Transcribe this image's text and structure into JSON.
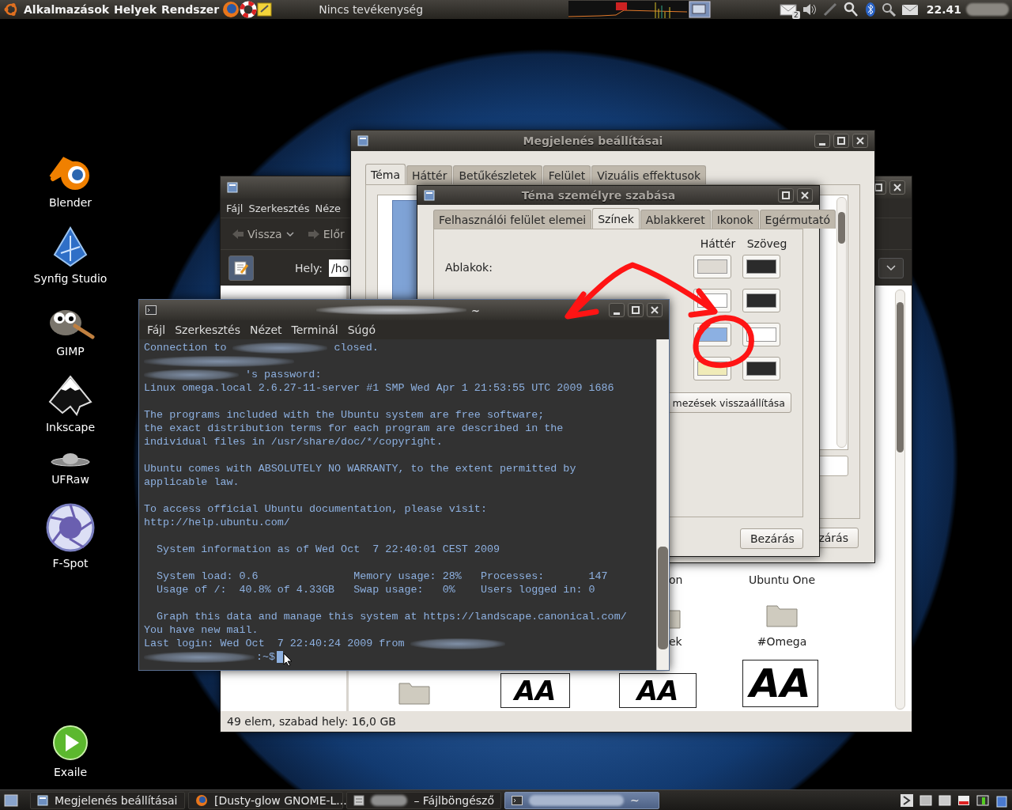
{
  "top_panel": {
    "menus": [
      "Alkalmazások",
      "Helyek",
      "Rendszer"
    ],
    "status": "Nincs tevékenység",
    "mail_count": "2",
    "clock": "22.41"
  },
  "desktop_icons": [
    {
      "kind": "blender",
      "label": "Blender"
    },
    {
      "kind": "synfig",
      "label": "Synfig Studio"
    },
    {
      "kind": "gimp",
      "label": "GIMP"
    },
    {
      "kind": "inkscape",
      "label": "Inkscape"
    },
    {
      "kind": "ufraw",
      "label": "UFRaw"
    },
    {
      "kind": "fspot",
      "label": "F-Spot"
    },
    {
      "kind": "exaile",
      "label": "Exaile"
    }
  ],
  "file_manager": {
    "menus": [
      "Fájl",
      "Szerkesztés",
      "Néze"
    ],
    "back": "Vissza",
    "forward": "Előr",
    "location_label": "Hely:",
    "location_value": "/ho",
    "items": [
      {
        "kind": "label",
        "label": "on"
      },
      {
        "kind": "label",
        "label": "Ubuntu One"
      },
      {
        "kind": "folder",
        "label": "ek"
      },
      {
        "kind": "folder",
        "label": "#Omega"
      },
      {
        "kind": "folder"
      },
      {
        "kind": "font",
        "sample": "AA"
      },
      {
        "kind": "font",
        "sample": "AA"
      },
      {
        "kind": "font",
        "sample": "AA"
      }
    ],
    "status": "49 elem, szabad hely: 16,0 GB"
  },
  "appearance_dialog": {
    "title": "Megjelenés beállításai",
    "tabs": [
      {
        "label": "Téma",
        "selected": true
      },
      {
        "label": "Háttér",
        "selected": false
      },
      {
        "label": "Betűkészletek",
        "selected": false
      },
      {
        "label": "Felület",
        "selected": false
      },
      {
        "label": "Vizuális effektusok",
        "selected": false
      }
    ],
    "close_button": "zárás"
  },
  "theme_dialog": {
    "title": "Téma személyre szabása",
    "tabs": [
      {
        "label": "Felhasználói felület elemei",
        "selected": false
      },
      {
        "label": "Színek",
        "selected": true
      },
      {
        "label": "Ablakkeret",
        "selected": false
      },
      {
        "label": "Ikonok",
        "selected": false
      },
      {
        "label": "Egérmutató",
        "selected": false
      }
    ],
    "columns": [
      "Háttér",
      "Szöveg"
    ],
    "rows": [
      {
        "label": "Ablakok:",
        "background": {
          "color": "#dedad3"
        },
        "text": {
          "color": "#2b2b2b"
        }
      },
      {
        "background": {
          "color": "#ffffff"
        },
        "text": {
          "color": "#2b2b2b"
        }
      },
      {
        "background": {
          "color": "#8cb0e2"
        },
        "text": {
          "color": "#ffffff"
        }
      },
      {
        "background": {
          "color": "#f0ebb8"
        },
        "text": {
          "color": "#2b2b2b"
        }
      }
    ],
    "reset_button": "mezések visszaállítása",
    "close_button": "Bezárás"
  },
  "terminal": {
    "title": "~",
    "menus": [
      "Fájl",
      "Szerkesztés",
      "Nézet",
      "Terminál",
      "Súgó"
    ],
    "lines": [
      {
        "kind": "text",
        "parts": [
          {
            "kind": "text",
            "text": "Connection to"
          },
          {
            "kind": "blur"
          },
          {
            "kind": "text",
            "text": "closed."
          }
        ]
      },
      {
        "kind": "text",
        "parts": [
          {
            "kind": "blur"
          }
        ]
      },
      {
        "kind": "text",
        "parts": [
          {
            "kind": "blur"
          },
          {
            "kind": "text",
            "text": "'s password:"
          }
        ]
      },
      {
        "kind": "text",
        "parts": [
          {
            "kind": "text",
            "text": "Linux omega.local 2.6.27-11-server #1 SMP Wed Apr 1 21:53:55 UTC 2009 i686"
          }
        ]
      },
      {
        "kind": "blank"
      },
      {
        "kind": "text",
        "parts": [
          {
            "kind": "text",
            "text": "The programs included with the Ubuntu system are free software;"
          }
        ]
      },
      {
        "kind": "text",
        "parts": [
          {
            "kind": "text",
            "text": "the exact distribution terms for each program are described in the"
          }
        ]
      },
      {
        "kind": "text",
        "parts": [
          {
            "kind": "text",
            "text": "individual files in /usr/share/doc/*/copyright."
          }
        ]
      },
      {
        "kind": "blank"
      },
      {
        "kind": "text",
        "parts": [
          {
            "kind": "text",
            "text": "Ubuntu comes with ABSOLUTELY NO WARRANTY, to the extent permitted by"
          }
        ]
      },
      {
        "kind": "text",
        "parts": [
          {
            "kind": "text",
            "text": "applicable law."
          }
        ]
      },
      {
        "kind": "blank"
      },
      {
        "kind": "text",
        "parts": [
          {
            "kind": "text",
            "text": "To access official Ubuntu documentation, please visit:"
          }
        ]
      },
      {
        "kind": "text",
        "parts": [
          {
            "kind": "text",
            "text": "http://help.ubuntu.com/"
          }
        ]
      },
      {
        "kind": "blank"
      },
      {
        "kind": "text",
        "parts": [
          {
            "kind": "text",
            "text": "  System information as of Wed Oct  7 22:40:01 CEST 2009"
          }
        ]
      },
      {
        "kind": "blank"
      },
      {
        "kind": "text",
        "parts": [
          {
            "kind": "text",
            "text": "  System load: 0.6               Memory usage: 28%   Processes:       147"
          }
        ]
      },
      {
        "kind": "text",
        "parts": [
          {
            "kind": "text",
            "text": "  Usage of /:  40.8% of 4.33GB   Swap usage:   0%    Users logged in: 0"
          }
        ]
      },
      {
        "kind": "blank"
      },
      {
        "kind": "text",
        "parts": [
          {
            "kind": "text",
            "text": "  Graph this data and manage this system at https://landscape.canonical.com/"
          }
        ]
      },
      {
        "kind": "text",
        "parts": [
          {
            "kind": "text",
            "text": "You have new mail."
          }
        ]
      },
      {
        "kind": "text",
        "parts": [
          {
            "kind": "text",
            "text": "Last login: Wed Oct  7 22:40:24 2009 from"
          },
          {
            "kind": "blur"
          }
        ]
      },
      {
        "kind": "prompt",
        "parts": [
          {
            "kind": "blur"
          },
          {
            "kind": "text",
            "text": ":~$"
          }
        ]
      }
    ]
  },
  "bottom_panel": {
    "tasks": [
      {
        "kind": "appearance",
        "label": "Megjelenés beállításai",
        "selected": false
      },
      {
        "kind": "browser",
        "label": "[Dusty-glow GNOME-L...",
        "selected": false
      },
      {
        "kind": "files",
        "label": "– Fájlböngésző",
        "blurred_prefix": true,
        "selected": false
      },
      {
        "kind": "terminal",
        "label": "~",
        "blurred_prefix": true,
        "selected": true
      }
    ]
  }
}
